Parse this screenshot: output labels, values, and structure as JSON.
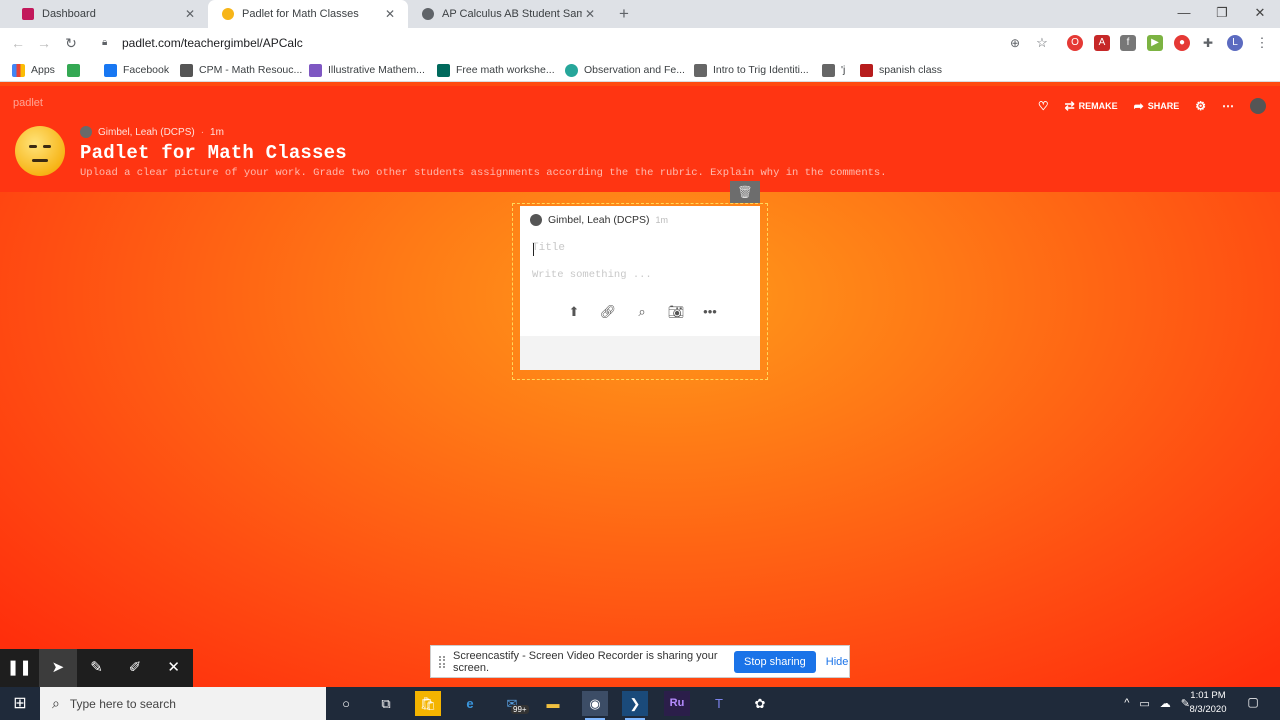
{
  "browser": {
    "tabs": [
      {
        "title": "Dashboard",
        "favicon_color": "#c2185b"
      },
      {
        "title": "Padlet for Math Classes",
        "favicon_color": "#f7b518"
      },
      {
        "title": "AP Calculus AB Student Sample (",
        "favicon_color": "#5f6368"
      }
    ],
    "new_tab": "+",
    "url": "padlet.com/teachergimbel/APCalc",
    "bookmarks": [
      {
        "label": "Apps"
      },
      {
        "label": ""
      },
      {
        "label": "Facebook"
      },
      {
        "label": "CPM - Math Resouc..."
      },
      {
        "label": "Illustrative Mathem..."
      },
      {
        "label": "Free math workshe..."
      },
      {
        "label": "Observation and Fe..."
      },
      {
        "label": "Intro to Trig Identiti..."
      },
      {
        "label": "'j"
      },
      {
        "label": "spanish class"
      }
    ],
    "profile_initial": "L"
  },
  "padlet": {
    "brand": "padlet",
    "author": "Gimbel, Leah (DCPS)",
    "time": "1m",
    "title": "Padlet for Math Classes",
    "description": "Upload a clear picture of your work. Grade two other students assignments according the the rubric. Explain why in the comments.",
    "actions": {
      "remake": "REMAKE",
      "share": "SHARE"
    }
  },
  "composer": {
    "author": "Gimbel, Leah (DCPS)",
    "time": "1m",
    "title_placeholder": "Title",
    "body_placeholder": "Write something ..."
  },
  "screencastify": {
    "message": "Screencastify - Screen Video Recorder is sharing your screen.",
    "stop_label": "Stop sharing",
    "hide_label": "Hide"
  },
  "taskbar": {
    "search_placeholder": "Type here to search",
    "mail_badge": "99+",
    "time": "1:01 PM",
    "date": "8/3/2020"
  },
  "colors": {
    "padlet_header": "#ff3512",
    "share_button": "#1a73e8",
    "taskbar": "#1f2a3a"
  }
}
